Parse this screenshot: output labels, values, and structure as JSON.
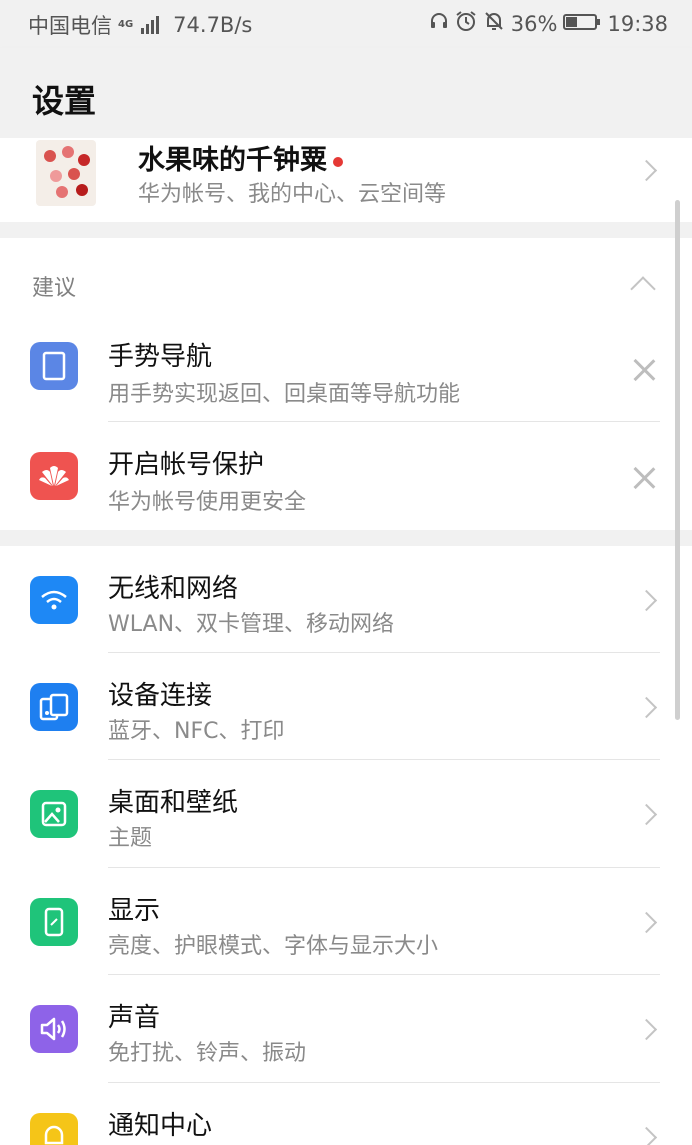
{
  "status_bar": {
    "carrier": "中国电信",
    "net_type": "4G",
    "speed": "74.7B/s",
    "battery": "36%",
    "time": "19:38"
  },
  "header": {
    "title": "设置"
  },
  "account": {
    "name": "水果味的千钟粟",
    "subtitle": "华为帐号、我的中心、云空间等"
  },
  "suggestions": {
    "title": "建议",
    "items": [
      {
        "title": "手势导航",
        "subtitle": "用手势实现返回、回桌面等导航功能",
        "icon": "phone-outline-icon",
        "color": "#5b86e5"
      },
      {
        "title": "开启帐号保护",
        "subtitle": "华为帐号使用更安全",
        "icon": "huawei-logo-icon",
        "color": "#ef5350"
      }
    ]
  },
  "settings": [
    {
      "title": "无线和网络",
      "subtitle": "WLAN、双卡管理、移动网络",
      "icon": "wifi-icon",
      "color": "#1e88f5"
    },
    {
      "title": "设备连接",
      "subtitle": "蓝牙、NFC、打印",
      "icon": "devices-icon",
      "color": "#1e7ff0"
    },
    {
      "title": "桌面和壁纸",
      "subtitle": "主题",
      "icon": "wallpaper-icon",
      "color": "#1fc47a"
    },
    {
      "title": "显示",
      "subtitle": "亮度、护眼模式、字体与显示大小",
      "icon": "display-icon",
      "color": "#1fc47a"
    },
    {
      "title": "声音",
      "subtitle": "免打扰、铃声、振动",
      "icon": "sound-icon",
      "color": "#8e63e8"
    },
    {
      "title": "通知中心",
      "subtitle": "",
      "icon": "bell-icon",
      "color": "#f5c518"
    }
  ]
}
